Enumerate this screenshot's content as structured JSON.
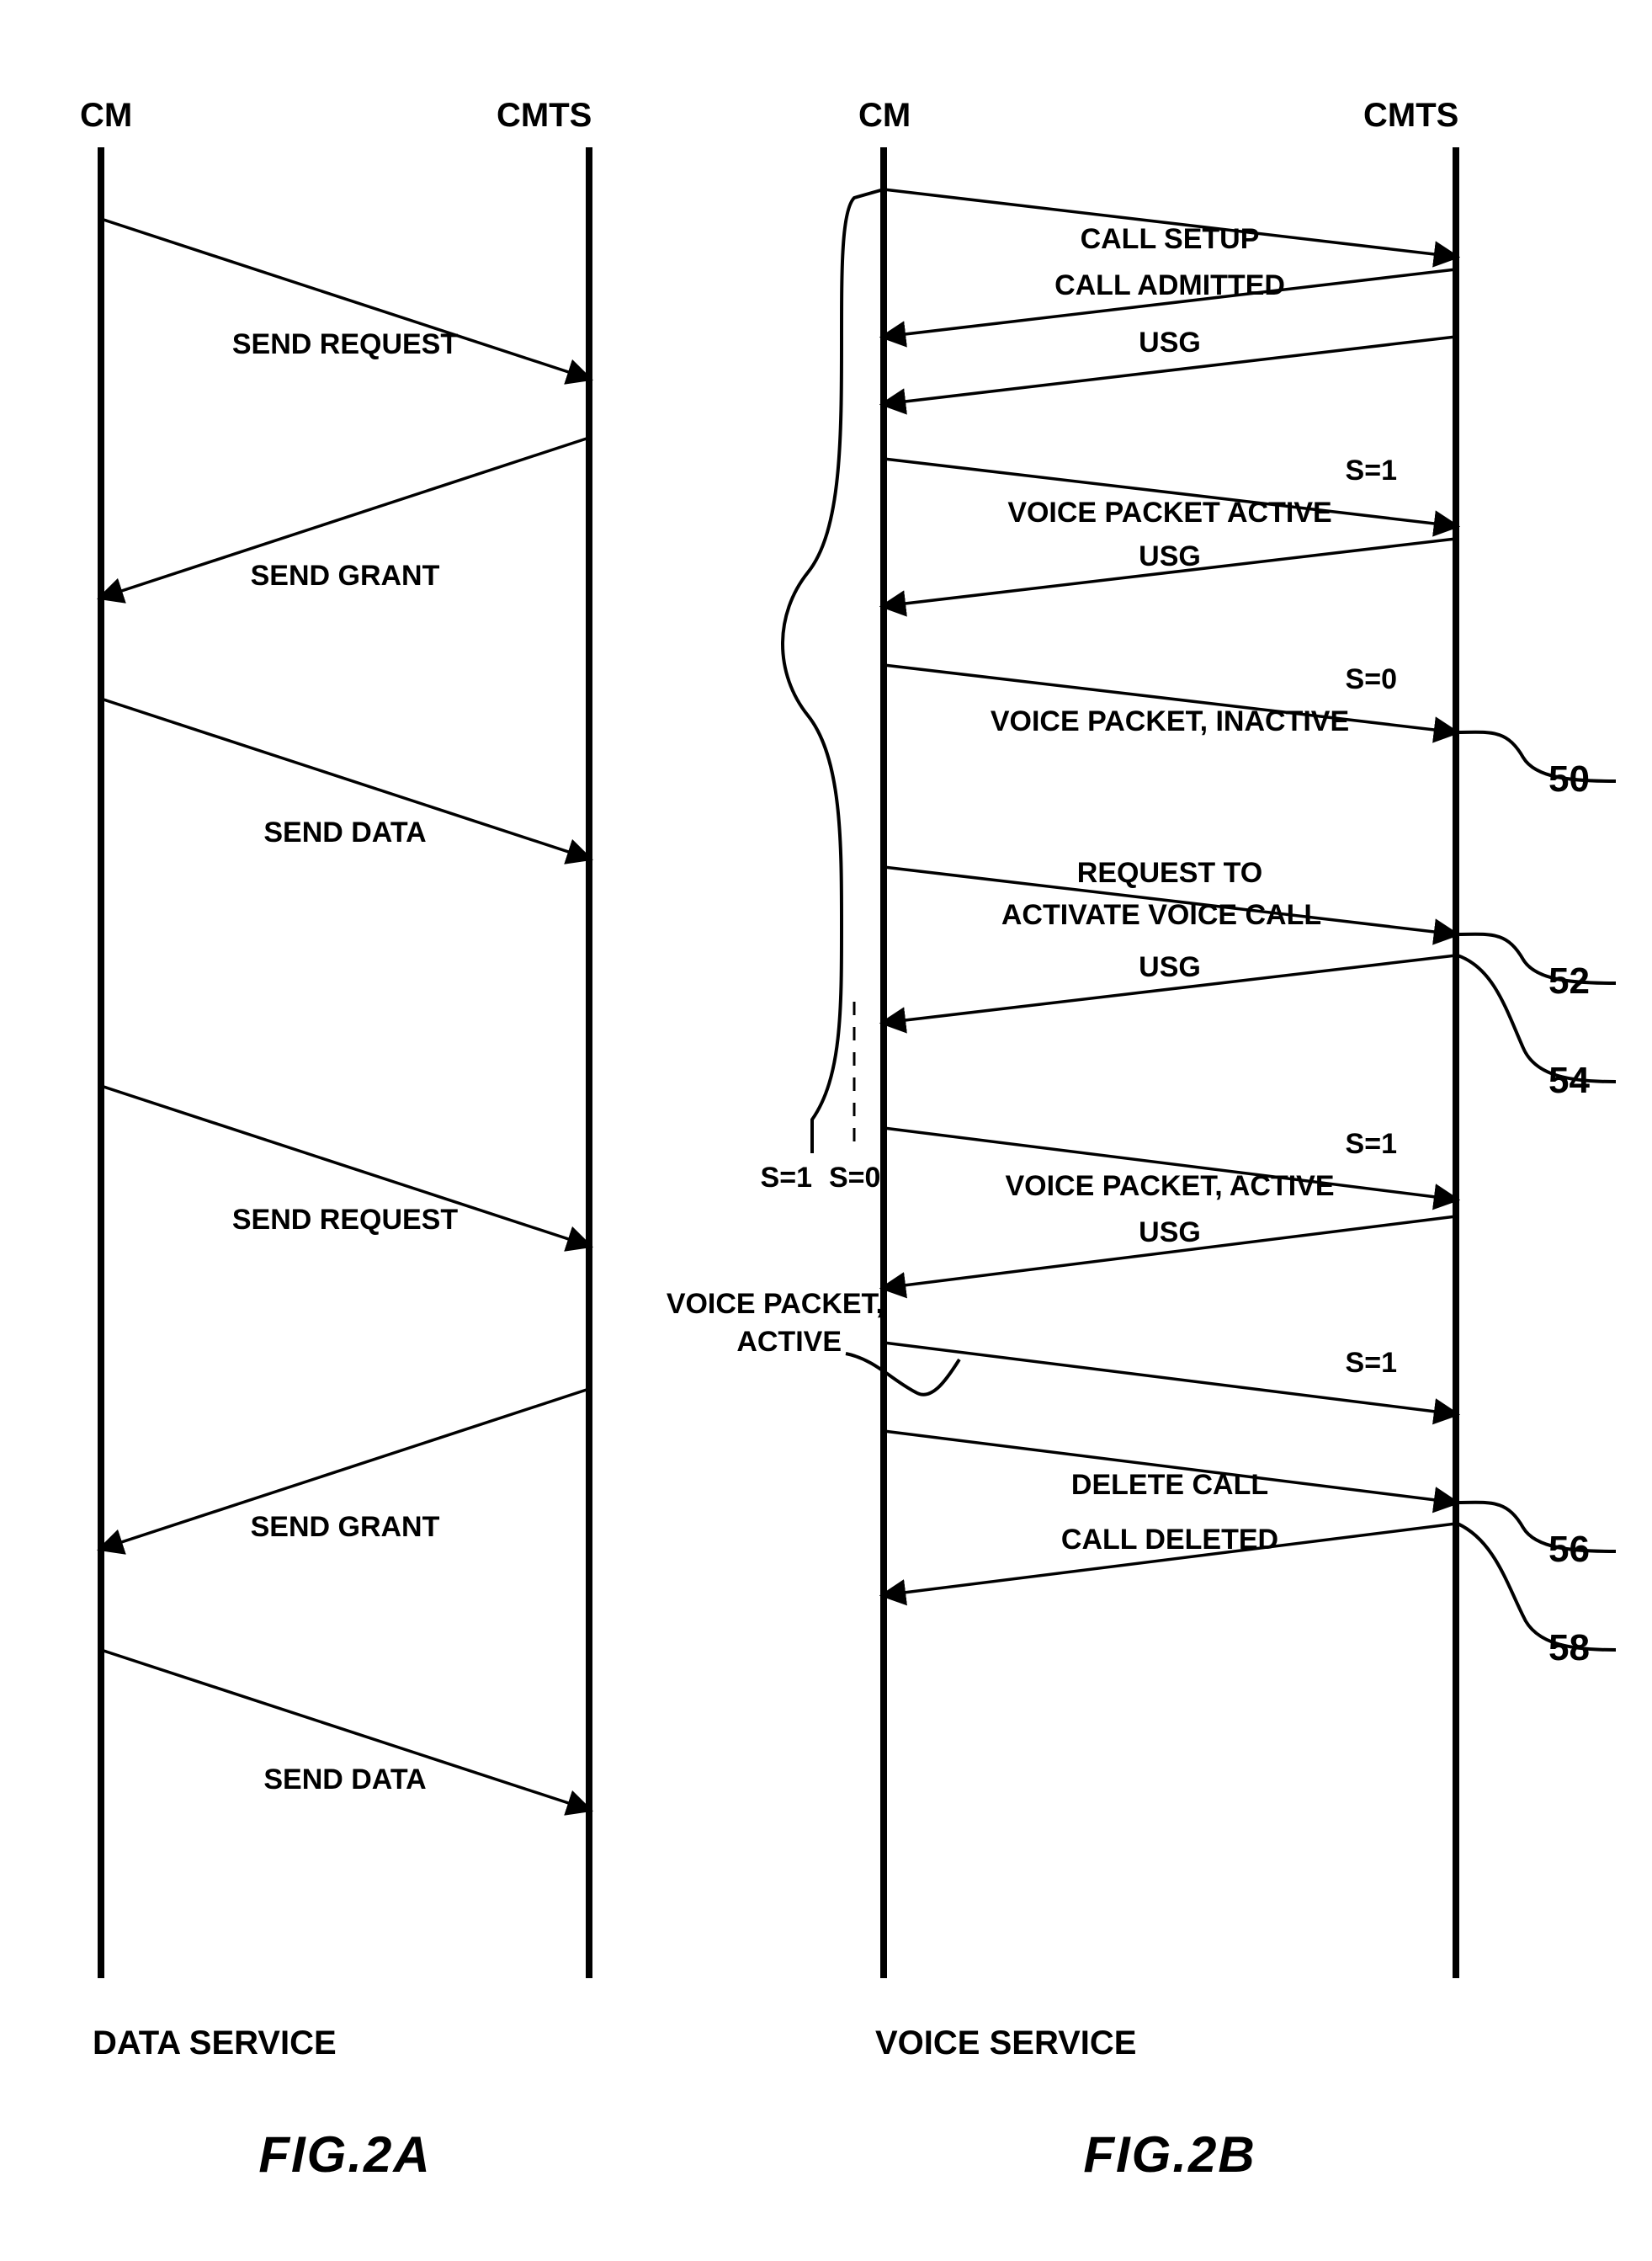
{
  "figA": {
    "header_left": "CM",
    "header_right": "CMTS",
    "caption": "DATA SERVICE",
    "figure_label": "FIG.2A",
    "messages": [
      {
        "label": "SEND REQUEST"
      },
      {
        "label": "SEND GRANT"
      },
      {
        "label": "SEND DATA"
      },
      {
        "label": "SEND REQUEST"
      },
      {
        "label": "SEND GRANT"
      },
      {
        "label": "SEND DATA"
      }
    ]
  },
  "figB": {
    "header_left": "CM",
    "header_right": "CMTS",
    "caption": "VOICE SERVICE",
    "figure_label": "FIG.2B",
    "wavy_bottom_left": "S=1",
    "wavy_bottom_right": "S=0",
    "side_label_line1": "VOICE PACKET,",
    "side_label_line2": "ACTIVE",
    "callouts": {
      "c50": "50",
      "c52": "52",
      "c54": "54",
      "c56": "56",
      "c58": "58"
    },
    "messages": [
      {
        "label": "CALL SETUP"
      },
      {
        "label": "CALL ADMITTED"
      },
      {
        "label": "USG"
      },
      {
        "label_right": "S=1",
        "label_main": "VOICE PACKET ACTIVE"
      },
      {
        "label": "USG"
      },
      {
        "label_right": "S=0",
        "label_main": "VOICE PACKET, INACTIVE"
      },
      {
        "label_top": "REQUEST TO",
        "label_main": "ACTIVATE VOICE CALL"
      },
      {
        "label": "USG"
      },
      {
        "label_right": "S=1",
        "label_main": "VOICE PACKET, ACTIVE"
      },
      {
        "label": "USG"
      },
      {
        "label_right": "S=1"
      },
      {
        "label": "DELETE CALL"
      },
      {
        "label": "CALL DELETED"
      }
    ]
  }
}
